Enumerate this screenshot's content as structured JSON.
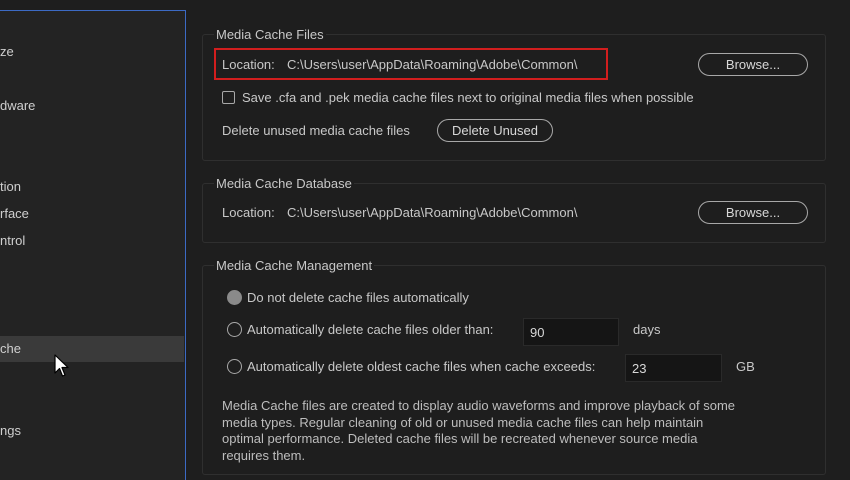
{
  "sidebar": {
    "items": [
      {
        "label": "ze"
      },
      {
        "label": "dware"
      },
      {
        "label": "tion"
      },
      {
        "label": "rface"
      },
      {
        "label": "ntrol"
      },
      {
        "label": "che",
        "selected": true
      },
      {
        "label": "ngs"
      }
    ]
  },
  "media_cache_files": {
    "title": "Media Cache Files",
    "location_label": "Location:",
    "location_path": "C:\\Users\\user\\AppData\\Roaming\\Adobe\\Common\\",
    "browse_label": "Browse...",
    "save_checkbox_label": "Save .cfa and .pek media cache files next to original media files when possible",
    "save_checked": false,
    "delete_unused_label": "Delete unused media cache files",
    "delete_unused_button": "Delete Unused"
  },
  "media_cache_database": {
    "title": "Media Cache Database",
    "location_label": "Location:",
    "location_path": "C:\\Users\\user\\AppData\\Roaming\\Adobe\\Common\\",
    "browse_label": "Browse..."
  },
  "media_cache_management": {
    "title": "Media Cache Management",
    "option_no_delete": "Do not delete cache files automatically",
    "option_older_than": "Automatically delete cache files older than:",
    "older_than_value": "90",
    "older_than_unit": "days",
    "option_exceeds": "Automatically delete oldest cache files when cache exceeds:",
    "exceeds_value": "23",
    "exceeds_unit": "GB",
    "selected_option": "no_delete",
    "description": "Media Cache files are created to display audio waveforms and improve playback of some media types.  Regular cleaning of old or unused media cache files can help maintain optimal performance. Deleted cache files will be recreated whenever source media requires them."
  },
  "colors": {
    "background": "#1e1e1e",
    "sidebar_border": "#3c6ac4",
    "highlight_box": "#d21e1e"
  }
}
